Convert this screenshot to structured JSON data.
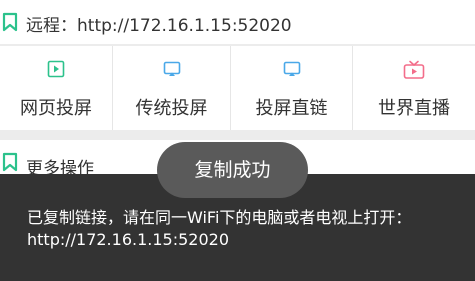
{
  "remote": {
    "text": "远程：http://172.16.1.15:52020",
    "icon": "bookmark-icon"
  },
  "cards": [
    {
      "label": "网页投屏",
      "icon": "play-square-icon",
      "color": "#2cc28c"
    },
    {
      "label": "传统投屏",
      "icon": "cast-screen-icon",
      "color": "#4aa8e8"
    },
    {
      "label": "投屏直链",
      "icon": "cast-screen-icon",
      "color": "#4aa8e8"
    },
    {
      "label": "世界直播",
      "icon": "tv-icon",
      "color": "#f36d8a"
    }
  ],
  "more": {
    "text": "更多操作",
    "icon": "bookmark-icon"
  },
  "toast": {
    "text": "复制成功"
  },
  "panel": {
    "message": "已复制链接，请在同一WiFi下的电脑或者电视上打开：http://172.16.1.15:52020"
  },
  "colors": {
    "accent": "#2cc28c",
    "panel_bg": "#333333",
    "toast_bg": "#5a5a5a"
  }
}
